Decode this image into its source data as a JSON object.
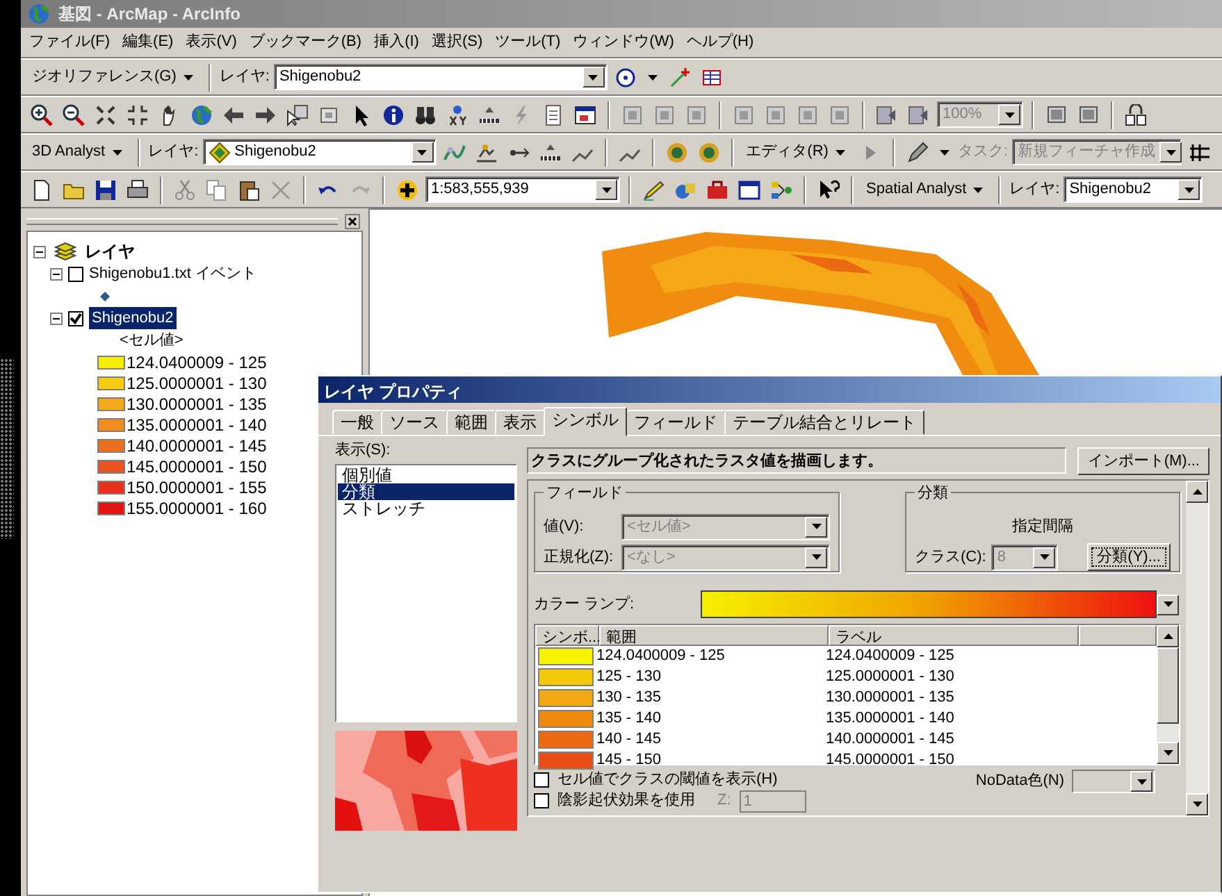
{
  "window": {
    "title": "基図 - ArcMap - ArcInfo"
  },
  "menu_bar": [
    "ファイル(F)",
    "編集(E)",
    "表示(V)",
    "ブックマーク(B)",
    "挿入(I)",
    "選択(S)",
    "ツール(T)",
    "ウィンドウ(W)",
    "ヘルプ(H)"
  ],
  "toolbars": [
    {
      "items": [
        {
          "kind": "menu",
          "label": "ジオリファレンス(G)"
        },
        {
          "kind": "label",
          "text": "レイヤ:",
          "disabled": false
        },
        {
          "kind": "combo",
          "value": "Shigenobu2",
          "disabled": false
        }
      ]
    },
    {
      "items": [
        {
          "kind": "combo",
          "value": "100%",
          "disabled": true
        }
      ]
    },
    {
      "items": [
        {
          "kind": "menu",
          "label": "3D Analyst"
        },
        {
          "kind": "label",
          "text": "レイヤ:",
          "disabled": false
        },
        {
          "kind": "combo",
          "value": "Shigenobu2",
          "disabled": false
        },
        {
          "kind": "menu",
          "label": "エディタ(R)"
        },
        {
          "kind": "label",
          "text": "タスク:",
          "disabled": true
        },
        {
          "kind": "combo",
          "value": "新規フィーチャ作成",
          "disabled": true
        }
      ]
    },
    {
      "items": [
        {
          "kind": "combo",
          "value": "1:583,555,939",
          "disabled": false
        },
        {
          "kind": "menu",
          "label": "Spatial Analyst"
        },
        {
          "kind": "label",
          "text": "レイヤ:",
          "disabled": false
        },
        {
          "kind": "combo",
          "value": "Shigenobu2",
          "disabled": false
        }
      ]
    }
  ],
  "toc": {
    "root": {
      "label": "レイヤ",
      "expanded": true,
      "children": [
        {
          "label": "Shigenobu1.txt イベント",
          "checked": false,
          "expanded": true,
          "selected": false
        },
        {
          "label": "Shigenobu2",
          "checked": true,
          "expanded": true,
          "selected": true,
          "legend_heading": "<セル値>",
          "classes": [
            {
              "label": "124.0400009 - 125",
              "color": "#f6f000"
            },
            {
              "label": "125.0000001 - 130",
              "color": "#f4cc10"
            },
            {
              "label": "130.0000001 - 135",
              "color": "#f2aa18"
            },
            {
              "label": "135.0000001 - 140",
              "color": "#ef8c1c"
            },
            {
              "label": "140.0000001 - 145",
              "color": "#ec6e1e"
            },
            {
              "label": "145.0000001 - 150",
              "color": "#ea5020"
            },
            {
              "label": "150.0000001 - 155",
              "color": "#e8301a"
            },
            {
              "label": "155.0000001 - 160",
              "color": "#e41212"
            }
          ]
        }
      ]
    }
  },
  "dialog": {
    "title": "レイヤ プロパティ",
    "tabs": [
      {
        "label": "一般",
        "selected": false
      },
      {
        "label": "ソース",
        "selected": false
      },
      {
        "label": "範囲",
        "selected": false
      },
      {
        "label": "表示",
        "selected": false
      },
      {
        "label": "シンボル",
        "selected": true
      },
      {
        "label": "フィールド",
        "selected": false
      },
      {
        "label": "テーブル結合とリレート",
        "selected": false
      }
    ],
    "show_label": "表示(S):",
    "show_list": [
      {
        "label": "個別値",
        "selected": false
      },
      {
        "label": "分類",
        "selected": true
      },
      {
        "label": "ストレッチ",
        "selected": false
      }
    ],
    "description": "クラスにグループ化されたラスタ値を描画します。",
    "import_button": "インポート(M)...",
    "field_group": {
      "title": "フィールド",
      "value_label": "値(V):",
      "value": "<セル値>",
      "normalize_label": "正規化(Z):",
      "normalize": "<なし>"
    },
    "classification": {
      "title": "分類",
      "method": "指定間隔",
      "class_label": "クラス(C):",
      "class_count": "8",
      "classify_button": "分類(Y)..."
    },
    "color_ramp": {
      "label": "カラー ランプ:"
    },
    "table": {
      "columns": [
        "シンボ...",
        "範囲",
        "ラベル"
      ],
      "rows": [
        {
          "color": "#f5f500",
          "range": "124.0400009 - 125",
          "label": "124.0400009 - 125"
        },
        {
          "color": "#f3c80a",
          "range": "125 - 130",
          "label": "125.0000001 - 130"
        },
        {
          "color": "#f2a810",
          "range": "130 - 135",
          "label": "130.0000001 - 135"
        },
        {
          "color": "#ef8a10",
          "range": "135 - 140",
          "label": "135.0000001 - 140"
        },
        {
          "color": "#ec6a12",
          "range": "140 - 145",
          "label": "140.0000001 - 145"
        },
        {
          "color": "#ea4e14",
          "range": "145 - 150",
          "label": "145.0000001 - 150"
        }
      ]
    },
    "options": [
      {
        "label": "セル値でクラスの閾値を表示(H)",
        "checked": false
      },
      {
        "label": "陰影起伏効果を使用",
        "checked": false
      }
    ],
    "z_label": "Z:",
    "z_value": "1",
    "nodata_label": "NoData色(N)"
  }
}
